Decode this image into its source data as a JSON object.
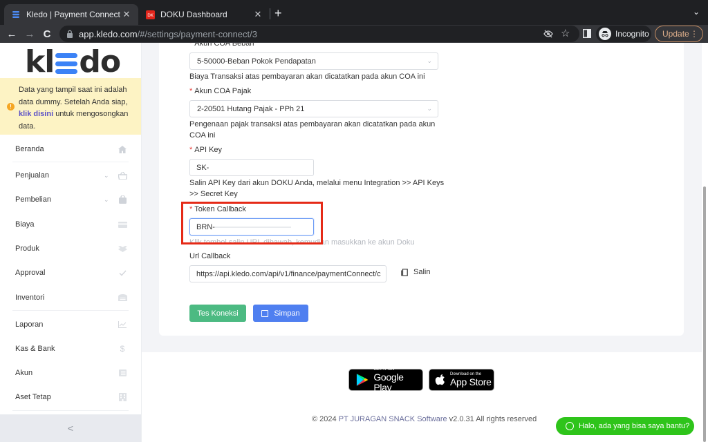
{
  "browser": {
    "tabs": [
      {
        "title": "Kledo | Payment Connect Doku",
        "active": true,
        "icon": "kledo-favicon"
      },
      {
        "title": "DOKU Dashboard",
        "active": false,
        "icon": "doku-favicon"
      }
    ],
    "close_glyph": "✕",
    "new_tab_glyph": "+",
    "tab_menu_glyph": "⌄",
    "url_host": "app.kledo.com",
    "url_path": "/#/settings/payment-connect/3",
    "incognito_label": "Incognito",
    "update_label": "Update",
    "menu_glyph": "⋮",
    "nav": {
      "back": "←",
      "forward": "→",
      "reload": "C"
    }
  },
  "sidebar": {
    "logo_pre": "kl",
    "logo_post": "do",
    "notice": {
      "line_a": "Data yang tampil saat ini adalah data dummy. Setelah Anda siap, ",
      "link": "klik disini",
      "line_b": " untuk mengosongkan data."
    },
    "items": [
      {
        "label": "Beranda",
        "icon": "home-icon",
        "glyph": "⌂",
        "expandable": false
      },
      {
        "label": "Penjualan",
        "icon": "basket-icon",
        "glyph": "🧺",
        "expandable": true
      },
      {
        "label": "Pembelian",
        "icon": "bag-icon",
        "glyph": "👜",
        "expandable": true
      },
      {
        "label": "Biaya",
        "icon": "credit-card-icon",
        "glyph": "▭",
        "expandable": false
      },
      {
        "label": "Produk",
        "icon": "box-icon",
        "glyph": "▣",
        "expandable": false
      },
      {
        "label": "Approval",
        "icon": "check-icon",
        "glyph": "✓",
        "expandable": false
      },
      {
        "label": "Inventori",
        "icon": "warehouse-icon",
        "glyph": "⌂",
        "expandable": false
      },
      {
        "label": "Laporan",
        "icon": "chart-icon",
        "glyph": "📈",
        "expandable": false
      },
      {
        "label": "Kas & Bank",
        "icon": "dollar-icon",
        "glyph": "$",
        "expandable": false
      },
      {
        "label": "Akun",
        "icon": "list-icon",
        "glyph": "☰",
        "expandable": false
      },
      {
        "label": "Aset Tetap",
        "icon": "building-icon",
        "glyph": "▦",
        "expandable": false
      }
    ],
    "chevron_glyph": "⌄",
    "collapse_glyph": "<"
  },
  "form": {
    "coa_beban": {
      "label": "Akun COA Beban",
      "value": "5-50000-Beban Pokok Pendapatan",
      "hint": "Biaya Transaksi atas pembayaran akan dicatatkan pada akun COA ini"
    },
    "coa_pajak": {
      "label": "Akun COA Pajak",
      "value": "2-20501 Hutang Pajak - PPh 21",
      "hint": "Pengenaan pajak transaksi atas pembayaran akan dicatatkan pada akun COA ini"
    },
    "api_key": {
      "label": "API Key",
      "value_prefix": "SK-",
      "hint": "Salin API Key dari akun DOKU Anda, melalui menu Integration >> API Keys >> Secret Key"
    },
    "token_callback": {
      "label": "Token Callback",
      "value_prefix": "BRN-",
      "hint": "Klik tombol salin URL dibawah, kemudian masukkan ke akun Doku"
    },
    "url_callback": {
      "label": "Url Callback",
      "value": "https://api.kledo.com/api/v1/finance/paymentConnect/c"
    },
    "required_mark": "*",
    "copy_label": "Salin",
    "caret_glyph": "⌄",
    "test_label": "Tes Koneksi",
    "save_label": "Simpan"
  },
  "footer": {
    "google_play_small": "GET IT ON",
    "google_play_big": "Google Play",
    "app_store_small": "Download on the",
    "app_store_big": "App Store",
    "copyright_pre": "© 2024 ",
    "brand": "PT JURAGAN SNACK Software",
    "copyright_post": " v2.0.31 All rights reserved"
  },
  "chat": {
    "label": "Halo, ada yang bisa saya bantu?"
  },
  "colors": {
    "primary": "#4f7ff0",
    "success": "#4cba82",
    "notice_bg": "#fdf3c4",
    "highlight": "#e52a17",
    "whatsapp": "#2ec41a"
  }
}
